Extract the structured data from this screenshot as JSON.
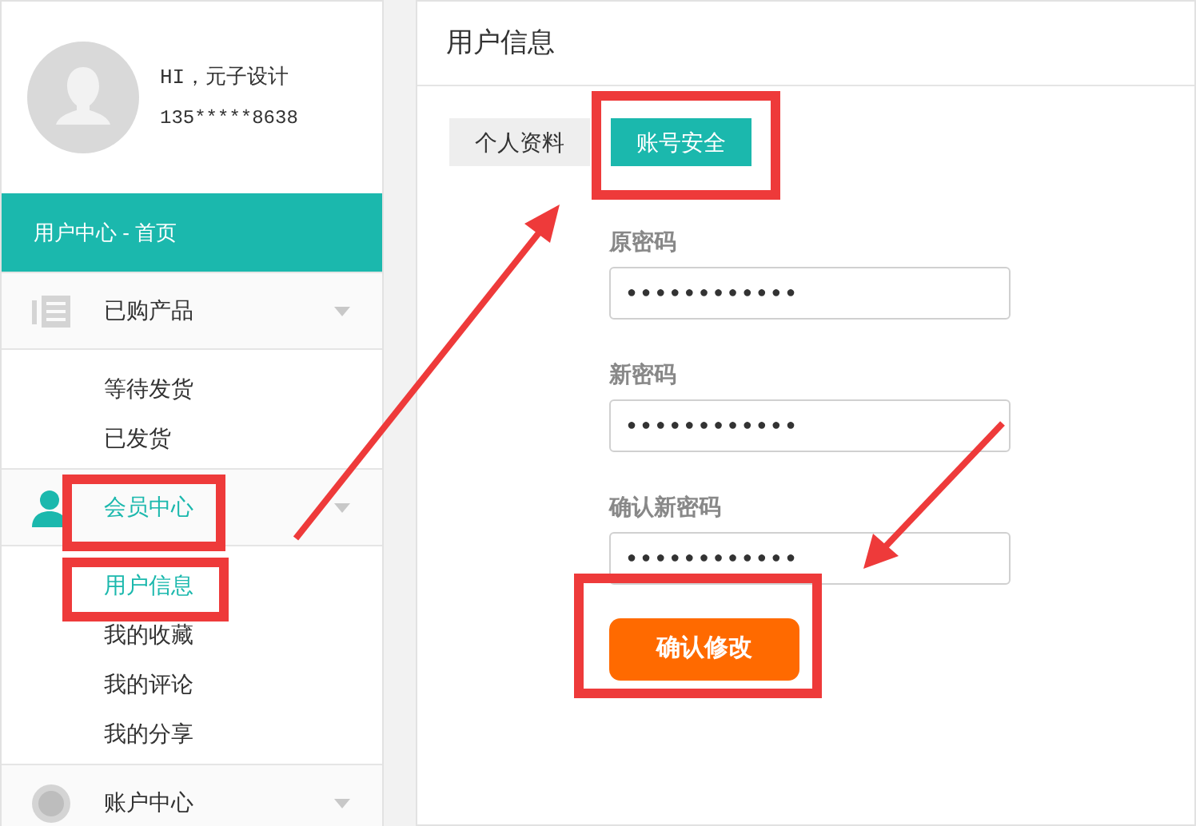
{
  "user": {
    "greeting": "HI，元子设计",
    "phone": "135*****8638"
  },
  "sidebar": {
    "home": "用户中心 - 首页",
    "groups": [
      {
        "label": "已购产品",
        "selected": false,
        "items": [
          {
            "label": "等待发货",
            "selected": false
          },
          {
            "label": "已发货",
            "selected": false
          }
        ]
      },
      {
        "label": "会员中心",
        "selected": true,
        "items": [
          {
            "label": "用户信息",
            "selected": true
          },
          {
            "label": "我的收藏",
            "selected": false
          },
          {
            "label": "我的评论",
            "selected": false
          },
          {
            "label": "我的分享",
            "selected": false
          }
        ]
      },
      {
        "label": "账户中心",
        "selected": false
      }
    ]
  },
  "main": {
    "title": "用户信息",
    "tabs": [
      {
        "label": "个人资料",
        "selected": false
      },
      {
        "label": "账号安全",
        "selected": true
      }
    ],
    "fields": [
      {
        "label": "原密码",
        "value": "●●●●●●●●●●●●"
      },
      {
        "label": "新密码",
        "value": "●●●●●●●●●●●●"
      },
      {
        "label": "确认新密码",
        "value": "●●●●●●●●●●●●"
      }
    ],
    "submit": "确认修改"
  }
}
